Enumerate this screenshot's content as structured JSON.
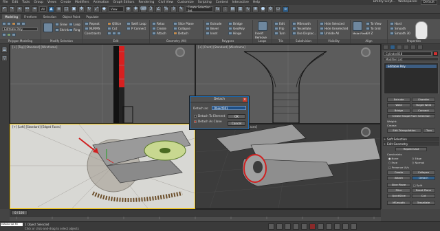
{
  "menubar": {
    "items": [
      "File",
      "Edit",
      "Tools",
      "Group",
      "Views",
      "Create",
      "Modifiers",
      "Animation",
      "Graph Editors",
      "Rendering",
      "Civil View",
      "Customize",
      "Scripting",
      "Content",
      "Interactive",
      "Help"
    ],
    "user": "Dmitry Sinyt...",
    "workspaces_label": "Workspaces:",
    "workspace": "Default"
  },
  "toolbar": {
    "filter_value": "All",
    "selection_set_placeholder": "Create Selection Set"
  },
  "ribbon_tabs": [
    "Modeling",
    "Freeform",
    "Selection",
    "Object Paint",
    "Populate"
  ],
  "ribbon": {
    "poly_modeling": {
      "object_field": "Editable Poly",
      "title": "Polygon Modeling"
    },
    "modify_selection": {
      "items": [
        "Grow",
        "Shrink",
        "Loop",
        "Ring"
      ],
      "title": "Modify Selection"
    },
    "edit": {
      "items": [
        "Repeat",
        "QSlice",
        "Swift Loop",
        "NURMS",
        "Cut",
        "P Connect",
        "Constraints"
      ],
      "title": "Edit"
    },
    "geometry": {
      "items": [
        "Relax",
        "Create",
        "Collapse",
        "Detach",
        "Attach",
        "Slice Plane"
      ],
      "title": "Geometry (All)"
    },
    "polygons": {
      "items": [
        "Extrude",
        "Bevel",
        "Inset",
        "Bridge",
        "Flip",
        "GeoPoly",
        "Outline",
        "Hinge"
      ],
      "title": "Polygons"
    },
    "loops": {
      "items": [
        "Insert",
        "Remove"
      ],
      "title": "Loops"
    },
    "tris": {
      "items": [
        "Edit",
        "Flip",
        "Turn"
      ],
      "title": "Tris"
    },
    "subdivision": {
      "items": [
        "MSmooth",
        "Tessellate",
        "Use Displac..."
      ],
      "title": "Subdivision"
    },
    "visibility": {
      "items": [
        "Hide Selected",
        "Hide Unselected",
        "Unhide All"
      ],
      "title": "Visibility"
    },
    "align": {
      "items": [
        "To View",
        "To Grid",
        "Make Planar",
        "X",
        "Y",
        "Z"
      ],
      "title": "Align"
    },
    "properties": {
      "items": [
        "Hard",
        "Smooth",
        "Smooth 30"
      ],
      "title": "Properties"
    }
  },
  "viewports": {
    "top_left": "[+] [Top] [Standard] [Wireframe]",
    "top_right": "[+] [Front] [Standard] [Wireframe]",
    "bottom_left": "[+] [Left] [Standard] [Edged Faces]",
    "bottom_right": "[+] [Perspective] [Standard] [Edged Faces]"
  },
  "command_panel": {
    "object_name": "Cylinder018",
    "object_color": "#d23030",
    "modifier_list": "Modifier List",
    "stack_item": "Editable Poly",
    "section_buttons": [
      "Extrude",
      "Chamfer",
      "Weld",
      "Target Weld",
      "Bridge",
      "Connect"
    ],
    "create_shape": "Create Shape From Selection",
    "weight_label": "Weight:",
    "crease_label": "Crease:",
    "edit_tri": "Edit Triangulation",
    "turn": "Turn",
    "soft_selection": "Soft Selection",
    "edit_geometry": "Edit Geometry",
    "repeat_last": "Repeat Last",
    "constraints": "Constraints",
    "none": "None",
    "edge": "Edge",
    "face": "Face",
    "normal": "Normal",
    "preserve_uvs": "Preserve UVs",
    "create": "Create",
    "collapse": "Collapse",
    "attach": "Attach",
    "detach": "Detach",
    "slice_plane": "Slice Plane",
    "split": "Split",
    "slice": "Slice",
    "reset_plane": "Reset Plane",
    "quickslice": "QuickSlice",
    "cut": "Cut",
    "msmooth": "MSmooth",
    "tessellate": "Tessellate"
  },
  "timeline": {
    "frame": "0 / 100"
  },
  "status": {
    "maxscript": "MAXScript Mi",
    "line1": "1 Object Selected",
    "line2": "Click or click-and-drag to select objects"
  },
  "dialog": {
    "title": "Detach",
    "detach_as_label": "Detach as:",
    "detach_as_value": "Object001",
    "to_element": "Detach To Element",
    "as_clone": "Detach As Clone",
    "ok": "OK",
    "cancel": "Cancel"
  }
}
